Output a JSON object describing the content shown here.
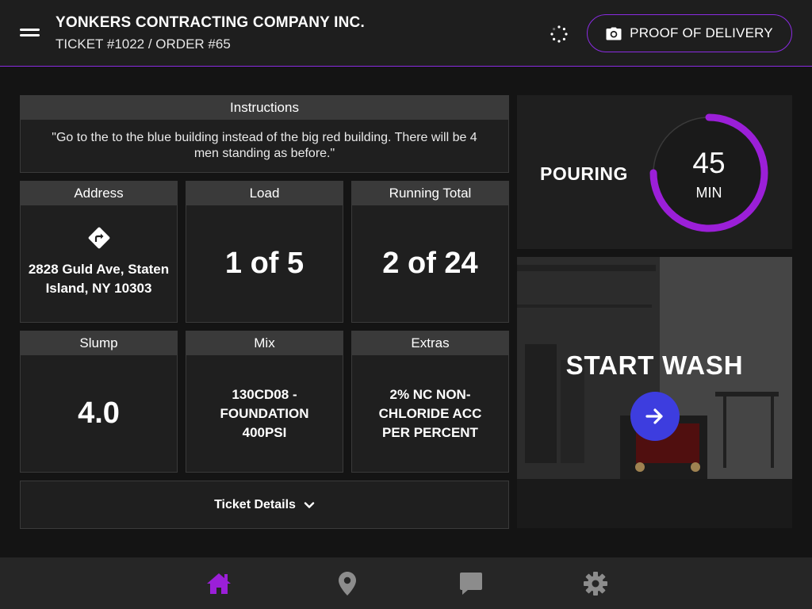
{
  "header": {
    "company": "YONKERS CONTRACTING COMPANY INC.",
    "ticket_line": "TICKET #1022 / ORDER #65",
    "proof_of_delivery_label": "PROOF OF DELIVERY",
    "accent_color": "#8a2be2"
  },
  "instructions": {
    "title": "Instructions",
    "text": "\"Go to the to the blue building instead of the big red building. There will be 4 men standing as before.\""
  },
  "address": {
    "title": "Address",
    "line1": "2828 Guld Ave, Staten",
    "line2": "Island, NY 10303",
    "icon": "directions-icon"
  },
  "load": {
    "title": "Load",
    "value": "1 of 5"
  },
  "running_total": {
    "title": "Running Total",
    "value": "2 of 24"
  },
  "slump": {
    "title": "Slump",
    "value": "4.0"
  },
  "mix": {
    "title": "Mix",
    "line1": "130CD08 -",
    "line2": "FOUNDATION",
    "line3": "400PSI"
  },
  "extras": {
    "title": "Extras",
    "line1": "2% NC NON-",
    "line2": "CHLORIDE ACC",
    "line3": "PER PERCENT"
  },
  "ticket_details": {
    "label": "Ticket Details"
  },
  "pouring": {
    "label": "POURING",
    "minutes": "45",
    "unit": "MIN",
    "progress": 0.75,
    "ring_color": "#9b1fd8"
  },
  "start_wash": {
    "label": "START WASH",
    "button_color": "#3d3ddf"
  },
  "bottom_nav": {
    "items": [
      "home-icon",
      "location-icon",
      "message-icon",
      "settings-icon"
    ],
    "active": "home-icon",
    "active_color": "#9b1fd8",
    "inactive_color": "#8c8c8c"
  }
}
